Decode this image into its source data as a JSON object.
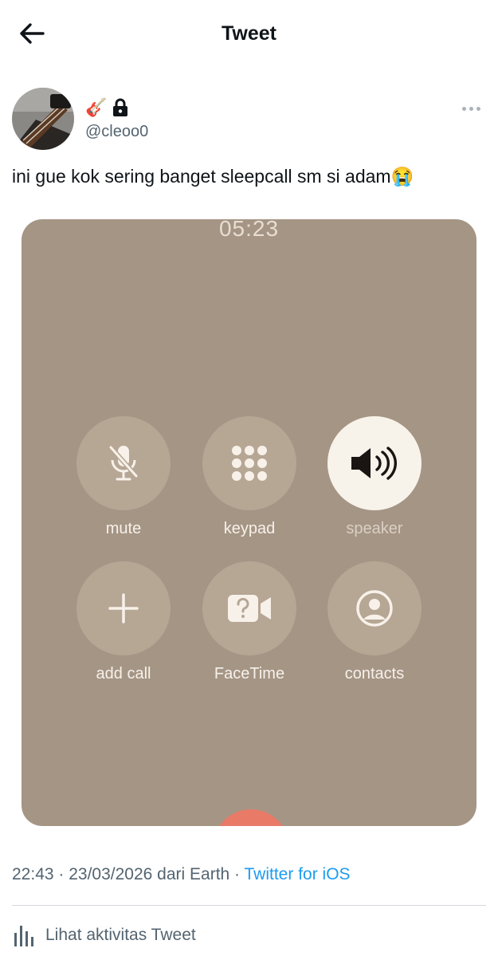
{
  "header": {
    "title": "Tweet",
    "back_icon": "arrow-left-icon"
  },
  "author": {
    "display_name_emoji": "🎸",
    "handle": "@cleoo0",
    "protected_icon": "lock-icon",
    "more_icon": "more-horizontal-icon"
  },
  "tweet": {
    "text": "ini gue kok sering banget sleepcall sm si adam😭"
  },
  "media": {
    "call_timer": "05:23",
    "buttons": [
      {
        "label": "mute",
        "icon": "mic-off-icon"
      },
      {
        "label": "keypad",
        "icon": "keypad-icon"
      },
      {
        "label": "speaker",
        "icon": "speaker-icon",
        "active": true
      },
      {
        "label": "add call",
        "icon": "plus-icon"
      },
      {
        "label": "FaceTime",
        "icon": "facetime-icon"
      },
      {
        "label": "contacts",
        "icon": "contacts-icon"
      }
    ]
  },
  "meta": {
    "time": "22:43",
    "sep1": " · ",
    "date_source": "23/03/2026 dari Earth",
    "sep2": " · ",
    "client": "Twitter for iOS"
  },
  "activity": {
    "label": "Lihat aktivitas Tweet",
    "icon": "analytics-icon"
  },
  "colors": {
    "accent": "#1d9bf0",
    "secondary_text": "#536471",
    "end_call": "#e97a68"
  }
}
